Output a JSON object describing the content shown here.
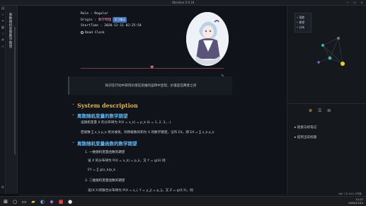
{
  "window": {
    "title": "Obsidian 0.9.18",
    "minimize": "—",
    "maximize": "☐",
    "close": "✕"
  },
  "ribbon": {
    "icons": [
      "folder-icon",
      "search-icon",
      "graph-icon",
      "calendar-icon",
      "star-icon",
      "tag-icon",
      "file-icon",
      "settings-icon"
    ]
  },
  "sidebar": {
    "vertical_title": "离散随机变量数学期望"
  },
  "meta": {
    "rule_label": "Rule : Regular",
    "origin_label": "Origin : ",
    "origin_value": "数学物理",
    "origin_tag": "学习笔记",
    "start_label": "StartTime : 2020-12-11 02:25:54",
    "deadclock": "Dead Clock"
  },
  "quote": "知识在行动中获得价值在思维的运转中显现，价值是在两者之间",
  "doc": {
    "h1": "System description",
    "s1_title": "离散随机变量的数学期望",
    "s1_p1": "设随机变量 X 的分布律为 P(X = x_k) = p_k (k = 1, 2, 3,…)",
    "s1_p2": "若级数 ∑ x_k p_k 绝对收敛，则称级数的和为 X 的数学期望，记作 EX，即 EX = ∑ x_k p_k",
    "s2_title": "离散随机变量函数的数学期望",
    "s2_item1": "1. 一维随机变量函数的期望",
    "s2_p1": "设 X 的分布律为 P(X = x_k) = p_k，又 Y = g(X) 则",
    "s2_p2": "EY = ∑ g(x_k)p_k",
    "s2_item2": "2. 二维随机变量函数的期望",
    "s2_p3": "设(X,Y)的联合分布律为 P(X = x_i, Y = y_j) = p_ij，又 Z = g(X,Y)，则"
  },
  "graph_panel": {
    "tabs": [
      "◀",
      "▶",
      "⋯"
    ],
    "legend": [
      "离散",
      "期望",
      "分布"
    ]
  },
  "outline_panel": {
    "toolbar": [
      "≣",
      "☰",
      "⊞"
    ],
    "items": [
      "链接与标笔记",
      "提到当前标题"
    ]
  },
  "status": "466 个字 2841 字符数",
  "clock": {
    "time": "11:27",
    "date": "2020/12/12"
  },
  "colors": {
    "accent": "#62b8f2",
    "heading": "#e0b24a",
    "tag": "#3b6fb6",
    "link": "#f08fb1"
  }
}
